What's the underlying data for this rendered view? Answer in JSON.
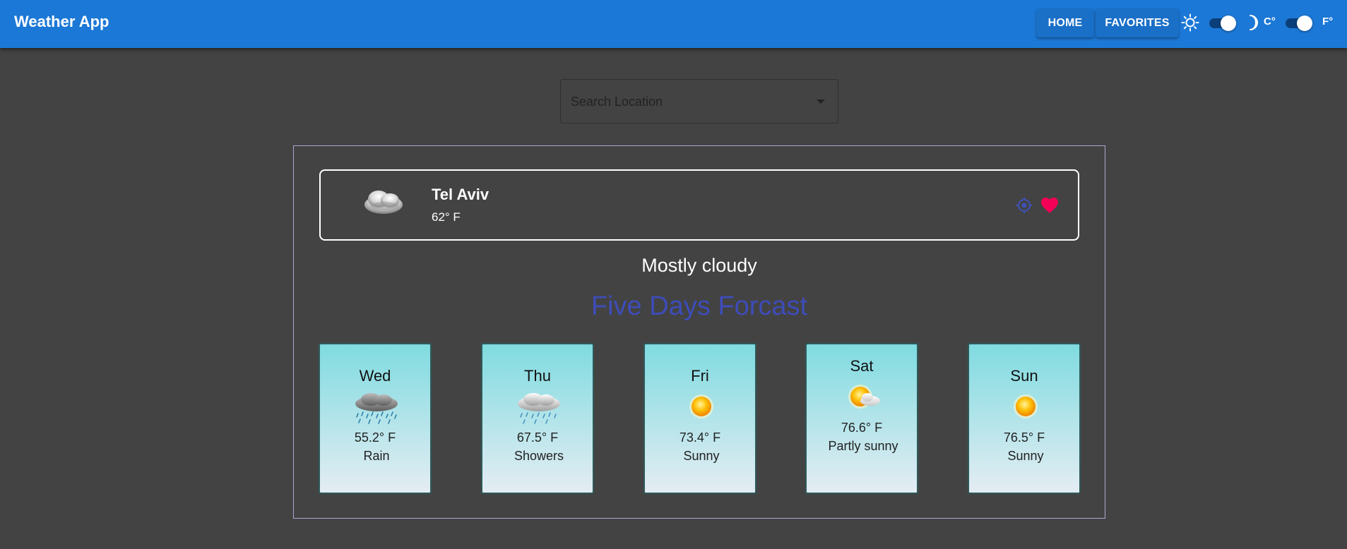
{
  "appbar": {
    "title": "Weather App",
    "home_label": "HOME",
    "favorites_label": "FAVORITES",
    "celsius_label": "C°",
    "fahrenheit_label": "F°",
    "theme_toggle_on": true,
    "unit_toggle_on": true
  },
  "search": {
    "placeholder": "Search Location",
    "value": ""
  },
  "current": {
    "city": "Tel Aviv",
    "temperature": "62° F",
    "condition": "Mostly cloudy",
    "icon": "mostly-cloudy-icon"
  },
  "forecast": {
    "title": "Five Days Forcast",
    "days": [
      {
        "day": "Wed",
        "temp": "55.2° F",
        "desc": "Rain",
        "icon": "rain-icon"
      },
      {
        "day": "Thu",
        "temp": "67.5° F",
        "desc": "Showers",
        "icon": "showers-icon"
      },
      {
        "day": "Fri",
        "temp": "73.4° F",
        "desc": "Sunny",
        "icon": "sun-icon"
      },
      {
        "day": "Sat",
        "temp": "76.6° F",
        "desc": "Partly sunny",
        "icon": "partly-sunny-icon"
      },
      {
        "day": "Sun",
        "temp": "76.5° F",
        "desc": "Sunny",
        "icon": "sun-icon"
      }
    ]
  },
  "colors": {
    "appbar": "#1c78d6",
    "background": "#434343",
    "forecast_title": "#3e4cb8",
    "favorite_heart": "#f50057",
    "location_icon": "#3f51b5"
  }
}
